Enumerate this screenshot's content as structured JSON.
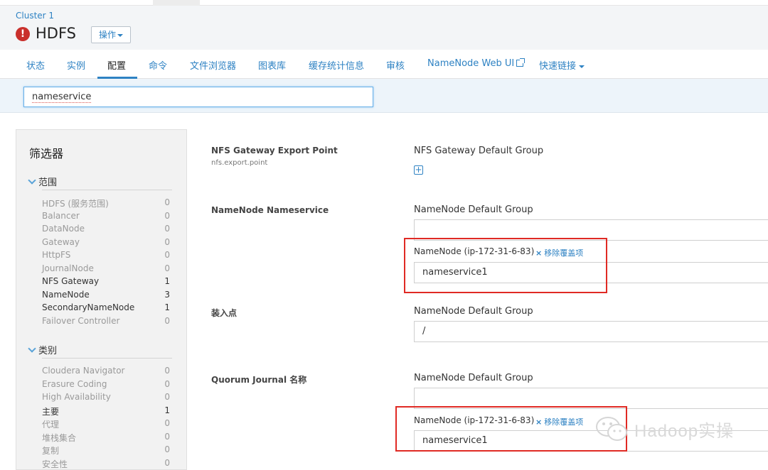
{
  "header": {
    "cluster": "Cluster 1",
    "service_name": "HDFS",
    "action_label": "操作"
  },
  "nav": {
    "tabs": [
      {
        "label": "状态"
      },
      {
        "label": "实例"
      },
      {
        "label": "配置",
        "active": true
      },
      {
        "label": "命令"
      },
      {
        "label": "文件浏览器"
      },
      {
        "label": "图表库"
      },
      {
        "label": "缓存统计信息"
      },
      {
        "label": "审核"
      },
      {
        "label": "NameNode Web UI"
      },
      {
        "label": "快速链接"
      }
    ]
  },
  "search": {
    "value": "nameservice"
  },
  "filters": {
    "title": "筛选器",
    "scope": {
      "heading": "范围",
      "items": [
        {
          "label": "HDFS (服务范围)",
          "count": "0"
        },
        {
          "label": "Balancer",
          "count": "0"
        },
        {
          "label": "DataNode",
          "count": "0"
        },
        {
          "label": "Gateway",
          "count": "0"
        },
        {
          "label": "HttpFS",
          "count": "0"
        },
        {
          "label": "JournalNode",
          "count": "0"
        },
        {
          "label": "NFS Gateway",
          "count": "1"
        },
        {
          "label": "NameNode",
          "count": "3"
        },
        {
          "label": "SecondaryNameNode",
          "count": "1"
        },
        {
          "label": "Failover Controller",
          "count": "0"
        }
      ]
    },
    "category": {
      "heading": "类别",
      "items": [
        {
          "label": "Cloudera Navigator",
          "count": "0"
        },
        {
          "label": "Erasure Coding",
          "count": "0"
        },
        {
          "label": "High Availability",
          "count": "0"
        },
        {
          "label": "主要",
          "count": "1"
        },
        {
          "label": "代理",
          "count": "0"
        },
        {
          "label": "堆栈集合",
          "count": "0"
        },
        {
          "label": "复制",
          "count": "0"
        },
        {
          "label": "安全性",
          "count": "0"
        }
      ]
    }
  },
  "properties": [
    {
      "label": "NFS Gateway Export Point",
      "key": "nfs.export.point",
      "group": "NFS Gateway Default Group"
    },
    {
      "label": "NameNode Nameservice",
      "group": "NameNode Default Group",
      "value": "",
      "override": {
        "label": "NameNode (ip-172-31-6-83)",
        "remove": "移除覆盖项",
        "value": "nameservice1"
      }
    },
    {
      "label": "装入点",
      "group": "NameNode Default Group",
      "value": "/"
    },
    {
      "label": "Quorum Journal 名称",
      "group": "NameNode Default Group",
      "value": "",
      "override": {
        "label": "NameNode (ip-172-31-6-83)",
        "remove": "移除覆盖项",
        "value": "nameservice1"
      }
    }
  ],
  "watermark": {
    "text": "Hadoop实操"
  },
  "colors": {
    "accent": "#2e82c3",
    "alert": "#c9302c",
    "highlight": "#e02a24"
  }
}
